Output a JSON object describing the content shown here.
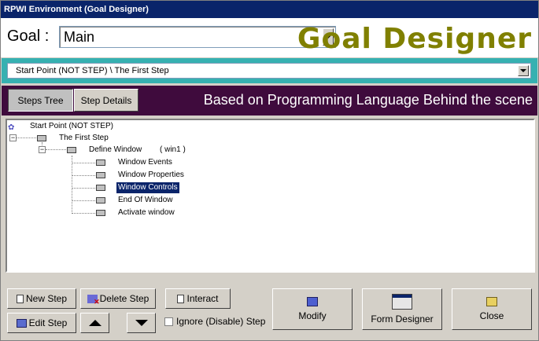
{
  "window": {
    "title": "RPWI Environment (Goal Designer)"
  },
  "goal": {
    "label": "Goal :",
    "selected": "Main"
  },
  "brand": {
    "title": "Goal Designer"
  },
  "path": {
    "selected": "Start Point (NOT STEP)  \\  The First Step"
  },
  "tabs": [
    {
      "label": "Steps Tree"
    },
    {
      "label": "Step Details"
    }
  ],
  "banner": "Based on Programming Language Behind the scene",
  "tree": {
    "root": "Start Point (NOT STEP)",
    "first_step": "The First Step",
    "define_window": "Define Window",
    "define_window_arg": "( win1 )",
    "children": [
      {
        "label": "Window Events"
      },
      {
        "label": "Window Properties"
      },
      {
        "label": "Window Controls"
      },
      {
        "label": "End Of Window"
      },
      {
        "label": "Activate window"
      }
    ],
    "selected": "Window Controls"
  },
  "buttons": {
    "new_step": "New Step",
    "delete_step": "Delete Step",
    "interact": "Interact",
    "edit_step": "Edit Step",
    "ignore_step": "Ignore (Disable) Step",
    "modify": "Modify",
    "form_designer": "Form Designer",
    "close": "Close"
  },
  "colors": {
    "title_bar": "#0a246a",
    "path_bar": "#36b1b1",
    "tab_bar": "#3f0b3d",
    "brand_text": "#808000",
    "selection": "#0a246a"
  },
  "checkboxes": {
    "ignore_step_checked": false
  }
}
